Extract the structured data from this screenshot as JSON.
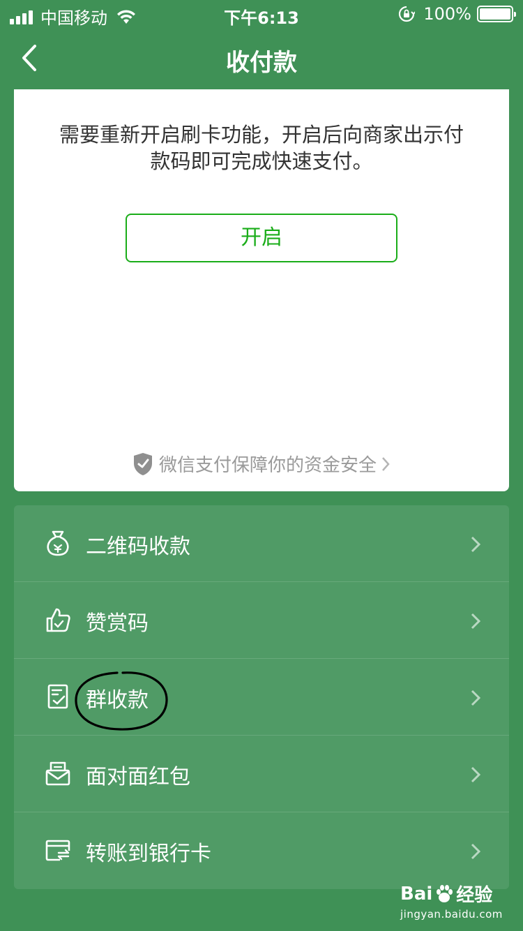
{
  "status_bar": {
    "carrier": "中国移动",
    "time": "下午6:13",
    "battery_percent": "100%",
    "battery_level": 1.0,
    "icons": [
      "signal-icon",
      "wifi-icon",
      "rotation-lock-icon",
      "battery-icon"
    ]
  },
  "nav": {
    "title": "收付款",
    "back_icon": "chevron-left-icon"
  },
  "card": {
    "message": "需要重新开启刷卡功能，开启后向商家出示付款码即可完成快速支付。",
    "open_button": "开启",
    "safety_text": "微信支付保障你的资金安全",
    "safety_icon": "shield-icon"
  },
  "menu": {
    "items": [
      {
        "label": "二维码收款",
        "icon": "money-bag-icon"
      },
      {
        "label": "赞赏码",
        "icon": "thumbs-up-icon"
      },
      {
        "label": "群收款",
        "icon": "group-receipt-icon"
      },
      {
        "label": "面对面红包",
        "icon": "red-packet-icon"
      },
      {
        "label": "转账到银行卡",
        "icon": "bank-transfer-icon"
      }
    ]
  },
  "watermark": {
    "brand_left": "Bai",
    "brand_right": "经验",
    "url": "jingyan.baidu.com"
  },
  "colors": {
    "background": "#3f9156",
    "list_background": "#509b66",
    "accent_green": "#1aad19",
    "card": "#ffffff",
    "message_text": "#333333",
    "muted_text": "#9a9a9a"
  }
}
